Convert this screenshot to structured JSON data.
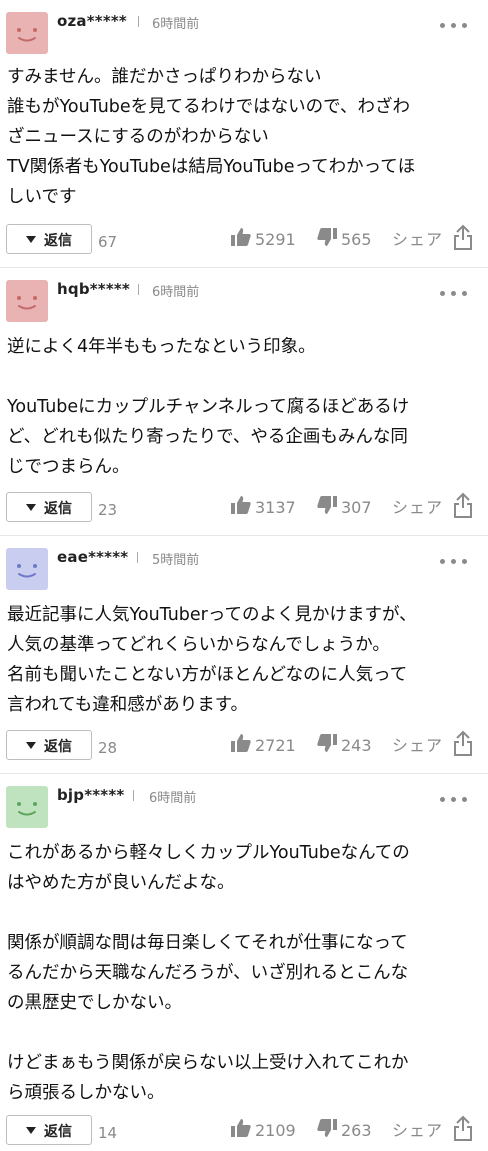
{
  "comments": [
    {
      "user": "oza*****",
      "time": "6時間前",
      "avatar_color": "#e9b3b3",
      "avatar_face": "#c56a6a",
      "text": "すみません。誰だかさっぱりわからない\n誰もがYouTubeを見てるわけではないので、わざわ\nざニュースにするのがわからない\nTV関係者もYouTubeは結局YouTubeってわかってほ\nしいです",
      "reply_label": "返信",
      "reply_count": "67",
      "likes": "5291",
      "dislikes": "565",
      "share_label": "シェア"
    },
    {
      "user": "hqb*****",
      "time": "6時間前",
      "avatar_color": "#e9b3b3",
      "avatar_face": "#c56a6a",
      "text": "逆によく4年半ももったなという印象。\n\nYouTubeにカップルチャンネルって腐るほどあるけ\nど、どれも似たり寄ったりで、やる企画もみんな同\nじでつまらん。",
      "reply_label": "返信",
      "reply_count": "23",
      "likes": "3137",
      "dislikes": "307",
      "share_label": "シェア"
    },
    {
      "user": "eae*****",
      "time": "5時間前",
      "avatar_color": "#c9cdf0",
      "avatar_face": "#6f78c9",
      "text": "最近記事に人気YouTuberってのよく見かけますが、\n人気の基準ってどれくらいからなんでしょうか。\n名前も聞いたことない方がほとんどなのに人気って\n言われても違和感があります。",
      "reply_label": "返信",
      "reply_count": "28",
      "likes": "2721",
      "dislikes": "243",
      "share_label": "シェア"
    },
    {
      "user": "bjp*****",
      "time": "6時間前",
      "avatar_color": "#bfe3bf",
      "avatar_face": "#5ea55e",
      "text": "これがあるから軽々しくカップルYouTubeなんての\nはやめた方が良いんだよな。\n\n関係が順調な間は毎日楽しくてそれが仕事になって\nるんだから天職なんだろうが、いざ別れるとこんな\nの黒歴史でしかない。\n\nけどまぁもう関係が戻らない以上受け入れてこれか\nら頑張るしかない。",
      "reply_label": "返信",
      "reply_count": "14",
      "likes": "2109",
      "dislikes": "263",
      "share_label": "シェア"
    }
  ]
}
